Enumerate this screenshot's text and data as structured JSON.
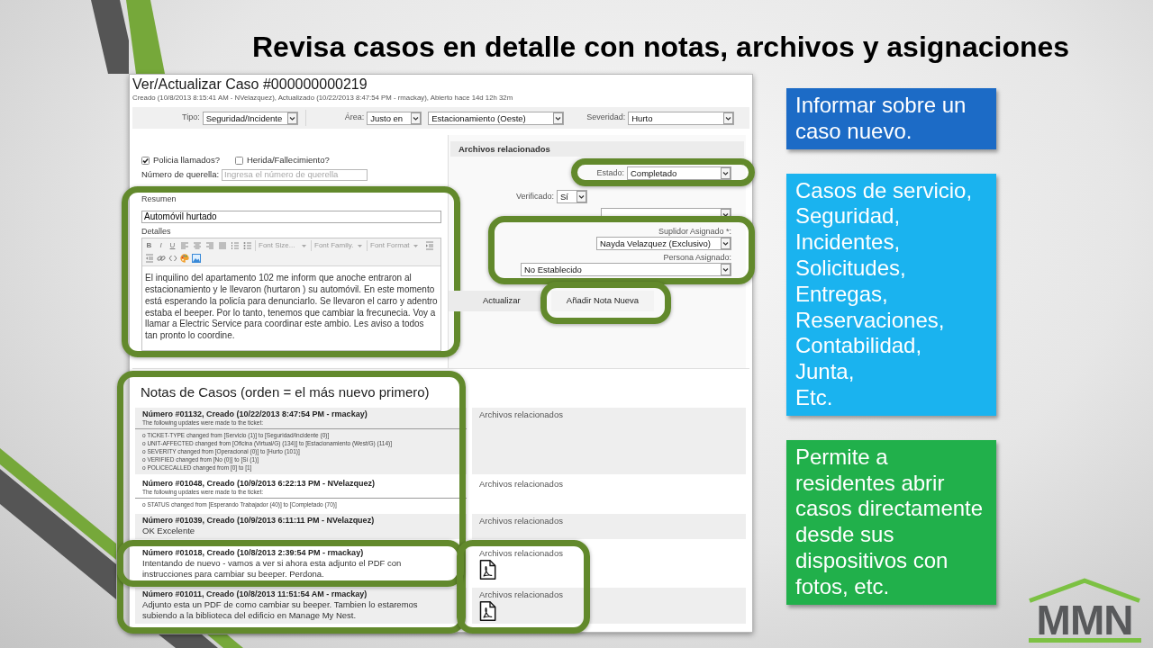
{
  "slide": {
    "title": "Revisa casos en detalle con notas, archivos y asignaciones"
  },
  "case": {
    "title": "Ver/Actualizar Caso #000000000219",
    "subtitle": "Creado (10/8/2013 8:15:41 AM - NVelazquez), Actualizado (10/22/2013 8:47:54 PM - rmackay), Abierto hace 14d 12h 32m",
    "filters": [
      {
        "label": "Tipo:",
        "selects": [
          "Seguridad/Incidente"
        ]
      },
      {
        "label": "Área:",
        "selects": [
          "Justo en",
          "Estacionamiento (Oeste)"
        ]
      },
      {
        "label": "Severidad:",
        "selects": [
          "Hurto"
        ]
      }
    ],
    "checkboxes": [
      {
        "label": "Policia llamados?",
        "checked": true
      },
      {
        "label": "Herida/Fallecimiento?",
        "checked": false
      }
    ],
    "complaint_number": {
      "label": "Número de querella:",
      "placeholder": "Ingresa el número de querella"
    },
    "description": {
      "highlighted": true,
      "summary_label": "Resumen",
      "summary_value": "Automóvil hurtado",
      "details_label": "Detalles",
      "format_buttons": [
        "B",
        "I",
        "U"
      ],
      "editor_dropdowns": [
        "Font Size...",
        "Font Family.",
        "Font Format"
      ],
      "details_text": "El inquilino del apartamento 102 me inform que anoche entraron al estacionamiento y le llevaron (hurtaron ) su automóvil. En este momento está esperando la policía para denunciarlo. Se llevaron el carro y adentro estaba el beeper. Por lo tanto, tenemos que cambiar la frecunecia. Voy a llamar a Electric Service para coordinar este ambio. Les aviso a todos tan pronto lo coordine."
    },
    "files_panel": {
      "title": "Archivos relacionados",
      "fields": [
        {
          "kind": "select",
          "label": "Estado:",
          "value": "Completado",
          "highlighted": true
        },
        {
          "kind": "select",
          "label": "Verificado:",
          "value": "Sí",
          "highlighted": false
        },
        {
          "kind": "select",
          "highlighted": false
        }
      ],
      "assignment": {
        "highlighted": true,
        "fields": [
          {
            "label": "Suplidor Asignado *:",
            "value": "Nayda Velazquez (Exclusivo)"
          },
          {
            "label": "Persona Asignado:",
            "value": "No Establecido"
          }
        ]
      },
      "buttons": [
        {
          "label": "Actualizar",
          "highlighted": false
        },
        {
          "label": "Añadir Nota Nueva",
          "highlighted": true
        }
      ]
    }
  },
  "notes": {
    "title": "Notas de Casos (orden = el más nuevo primero)",
    "highlighted": true,
    "items": [
      {
        "kind": "update",
        "header": "Número #01132, Creado (10/22/2013 8:47:54 PM - rmackay)",
        "intro": "The following updates were made to the ticket:",
        "changes": [
          "o TICKET-TYPE changed from [Servicio (1)] to [Seguridad/Incidente (0)]",
          "o UNIT-AFFECTED changed from [Oficina (Virtual/G) (134)] to [Estacionamiento (West/G) (114)]",
          "o SEVERITY changed from [Operacional (0)] to [Hurto (101)]",
          "o VERIFIED changed from [No (0)] to [Sí (1)]",
          "o POLICECALLED changed from [0] to [1]"
        ],
        "files_label": "Archivos relacionados",
        "highlighted": false,
        "files_highlighted": false
      },
      {
        "kind": "update",
        "header": "Número #01048, Creado (10/9/2013 6:22:13 PM - NVelazquez)",
        "intro": "The following updates were made to the ticket:",
        "changes": [
          "o STATUS changed from [Esperando Trabajador (40)] to [Completado (70)]"
        ],
        "files_label": "Archivos relacionados",
        "highlighted": false,
        "files_highlighted": false
      },
      {
        "kind": "comment",
        "header": "Número #01039, Creado (10/9/2013 6:11:11 PM - NVelazquez)",
        "text": "OK Excelente",
        "files_label": "Archivos relacionados",
        "highlighted": false,
        "files_highlighted": false
      },
      {
        "kind": "comment",
        "header": "Número #01018, Creado (10/8/2013 2:39:54 PM - rmackay)",
        "text": "Intentando de nuevo - vamos a ver si ahora esta adjunto el PDF con instrucciones para cambiar su beeper. Perdona.",
        "files_label": "Archivos relacionados",
        "attachments": [
          {
            "kind": "pdf"
          }
        ],
        "highlighted": true,
        "files_highlighted": true
      },
      {
        "kind": "comment",
        "header": "Número #01011, Creado (10/8/2013 11:51:54 AM - rmackay)",
        "text": "Adjunto esta un PDF de como cambiar su beeper. Tambien lo estaremos subiendo a la biblioteca del edificio en Manage My Nest.",
        "files_label": "Archivos relacionados",
        "attachments": [
          {
            "kind": "pdf"
          }
        ],
        "highlighted": false,
        "files_highlighted": true
      }
    ]
  },
  "callouts": [
    {
      "color": "#1c6bc6",
      "lines": [
        "Informar sobre un caso nuevo."
      ]
    },
    {
      "color": "#1ab3ef",
      "lines": [
        "Casos de servicio,",
        "Seguridad,",
        "Incidentes,",
        "Solicitudes,",
        "Entregas,",
        "Reservaciones,",
        "Contabilidad,",
        "Junta,",
        "Etc."
      ]
    },
    {
      "color": "#21b04b",
      "lines": [
        "Permite a residentes abrir casos directamente desde sus dispositivos con fotos, etc."
      ]
    }
  ],
  "logo": {
    "text": "MMN"
  }
}
